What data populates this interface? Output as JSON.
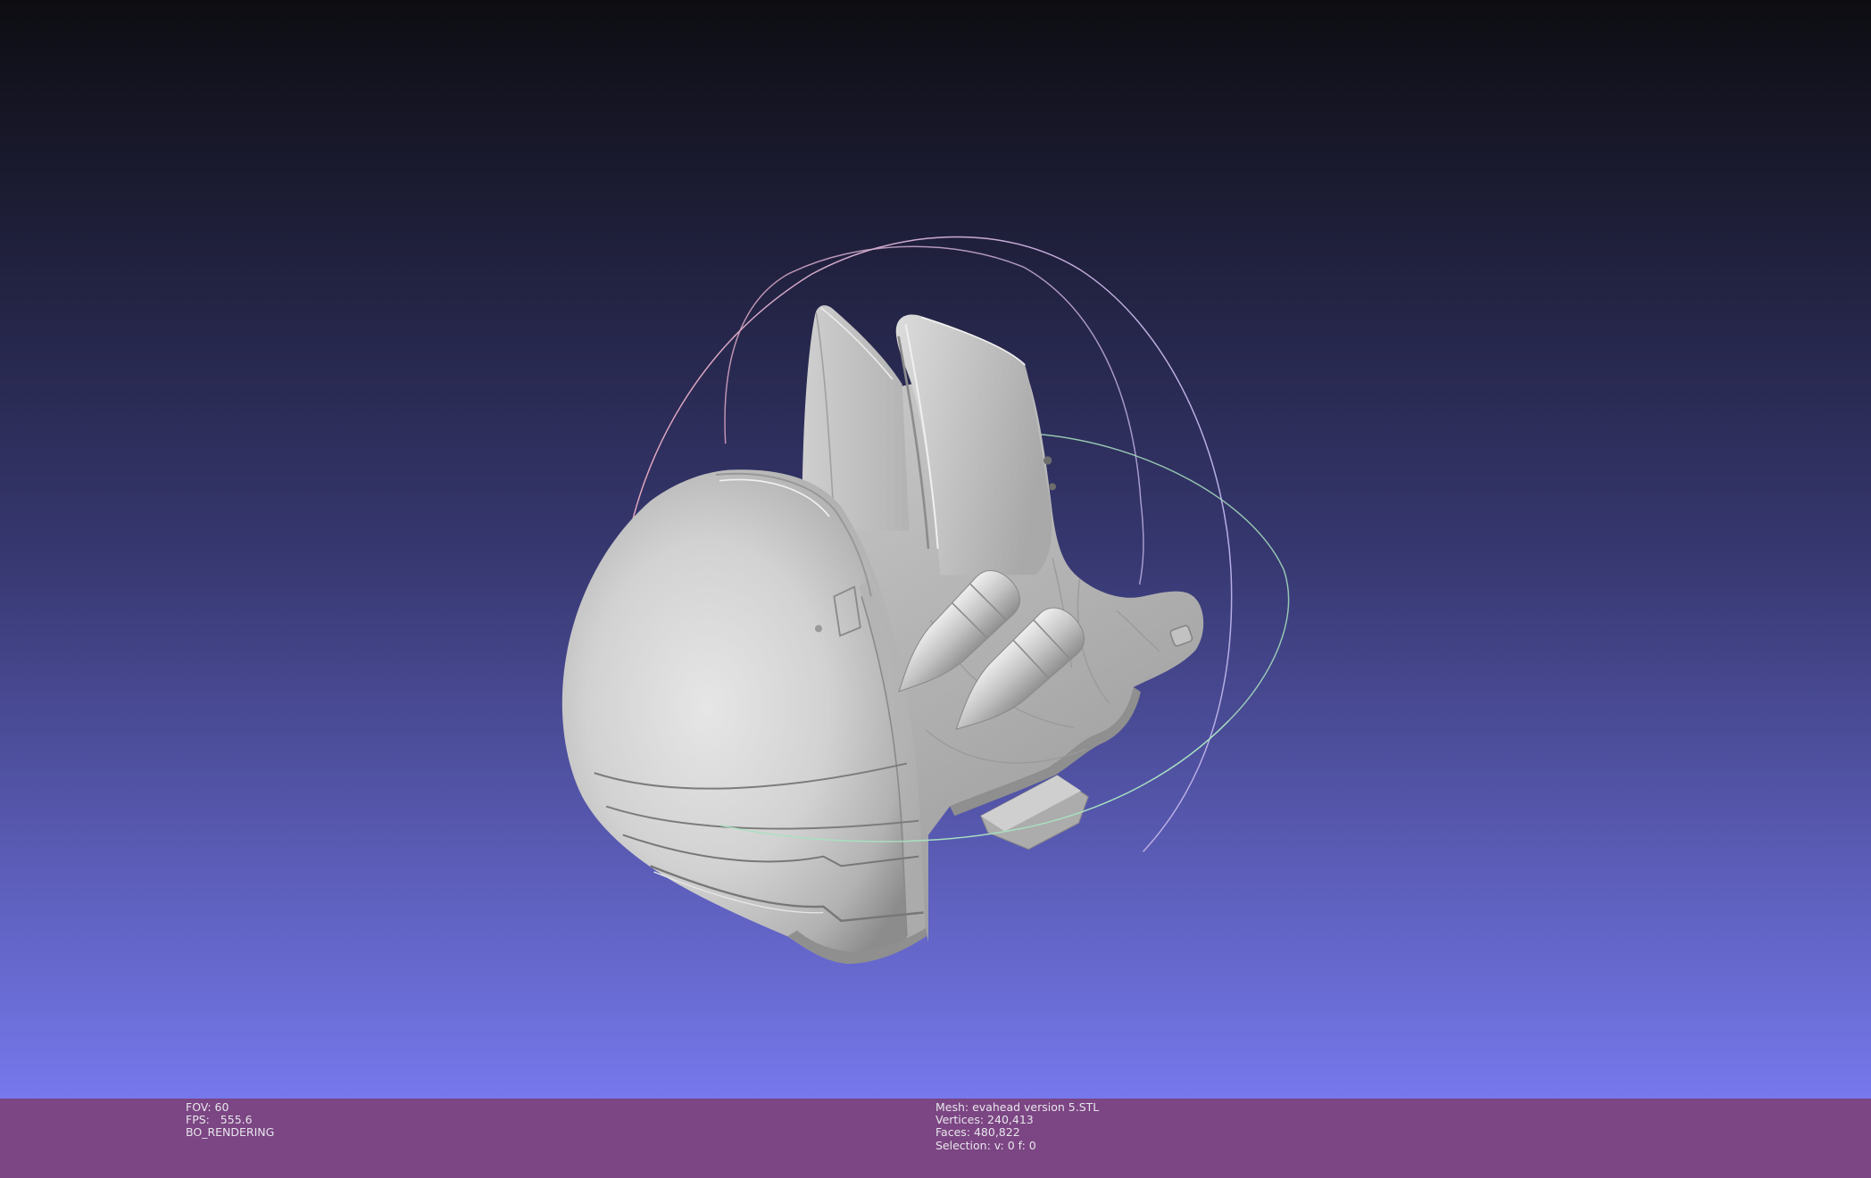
{
  "colors": {
    "background_top": "#0d0d12",
    "background_mid": "#36376f",
    "background_bottom": "#7678ec",
    "info_bar": "#7c4583",
    "info_text": "#e6e6ec",
    "mesh_light": "#e6e6e6",
    "mesh_shadow": "#8c8c8c",
    "trackball_red": "#e3a6bd",
    "trackball_green": "#a8e0c0",
    "trackball_blue": "#b7b0e8"
  },
  "info_bar": {
    "left": {
      "fov": "FOV: 60",
      "fps": "FPS:   555.6",
      "render_mode": "BO_RENDERING"
    },
    "right": {
      "mesh": "Mesh: evahead version 5.STL",
      "vertices": "Vertices: 240,413",
      "faces": "Faces: 480,822",
      "selection": "Selection: v: 0 f: 0"
    }
  }
}
